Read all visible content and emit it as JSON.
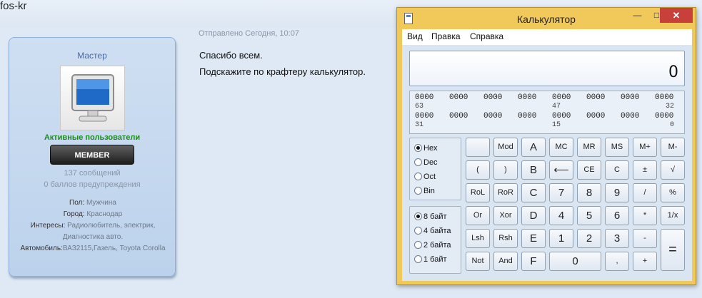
{
  "page": {
    "username": "fos-kr"
  },
  "profile": {
    "title": "Мастер",
    "group": "Активные пользователи",
    "rank": "MEMBER",
    "posts": "137 сообщений",
    "warnings": "0 баллов предупреждения",
    "gender_label": "Пол:",
    "gender": "Мужчина",
    "city_label": "Город:",
    "city": "Краснодар",
    "interests_label": "Интересы:",
    "interests": "Радиолюбитель, электрик, Диагностика авто.",
    "car_label": "Автомобиль:",
    "car": "ВАЗ2115,Газель, Toyota Corolla"
  },
  "post": {
    "meta": "Отправлено Сегодня, 10:07",
    "line1": "Спасибо всем.",
    "line2": "Подскажите по крафтеру калькулятор."
  },
  "calculator": {
    "title": "Калькулятор",
    "window_buttons": {
      "minimize": "—",
      "maximize": "□",
      "close": "✕"
    },
    "menu": [
      "Вид",
      "Правка",
      "Справка"
    ],
    "display_value": "0",
    "bits": {
      "row1": [
        "0000",
        "0000",
        "0000",
        "0000",
        "0000",
        "0000",
        "0000",
        "0000"
      ],
      "row1_labels": [
        "63",
        "47",
        "32"
      ],
      "row2": [
        "0000",
        "0000",
        "0000",
        "0000",
        "0000",
        "0000",
        "0000",
        "0000"
      ],
      "row2_labels": [
        "31",
        "15",
        "0"
      ]
    },
    "base_options": [
      "Hex",
      "Dec",
      "Oct",
      "Bin"
    ],
    "base_selected": "Hex",
    "word_options": [
      "8 байт",
      "4 байта",
      "2 байта",
      "1 байт"
    ],
    "word_selected": "8 байт",
    "keys": [
      "",
      "Mod",
      "A",
      "MC",
      "MR",
      "MS",
      "M+",
      "M-",
      "(",
      ")",
      "B",
      "⟵",
      "CE",
      "C",
      "±",
      "√",
      "RoL",
      "RoR",
      "C",
      "7",
      "8",
      "9",
      "/",
      "%",
      "Or",
      "Xor",
      "D",
      "4",
      "5",
      "6",
      "*",
      "1/x",
      "Lsh",
      "Rsh",
      "E",
      "1",
      "2",
      "3",
      "-",
      "=",
      "Not",
      "And",
      "F",
      "0",
      ",",
      "+"
    ]
  }
}
